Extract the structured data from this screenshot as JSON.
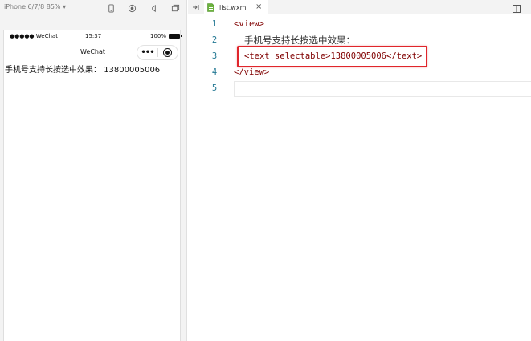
{
  "simulator": {
    "device": "iPhone 6/7/8 85% ▾",
    "icons": [
      "phone-icon",
      "record-icon",
      "sound-icon",
      "window-icon",
      "detach-icon"
    ],
    "status_bar": {
      "signal": "●●●●● WeChat",
      "time": "15:37",
      "battery": "100%"
    },
    "nav": {
      "title": "WeChat",
      "more": "•••"
    },
    "content": {
      "label": "手机号支持长按选中效果：",
      "phone": "13800005006"
    }
  },
  "editor": {
    "tab": {
      "filename": "list.wxml",
      "close": "×"
    },
    "lines": [
      {
        "number": "1",
        "code": "<view>"
      },
      {
        "number": "2",
        "code": "手机号支持长按选中效果："
      },
      {
        "number": "3",
        "code": "<text selectable>13800005006</text>"
      },
      {
        "number": "4",
        "code": "</view>"
      },
      {
        "number": "5",
        "code": ""
      }
    ],
    "highlight_color": "#e0252b"
  }
}
